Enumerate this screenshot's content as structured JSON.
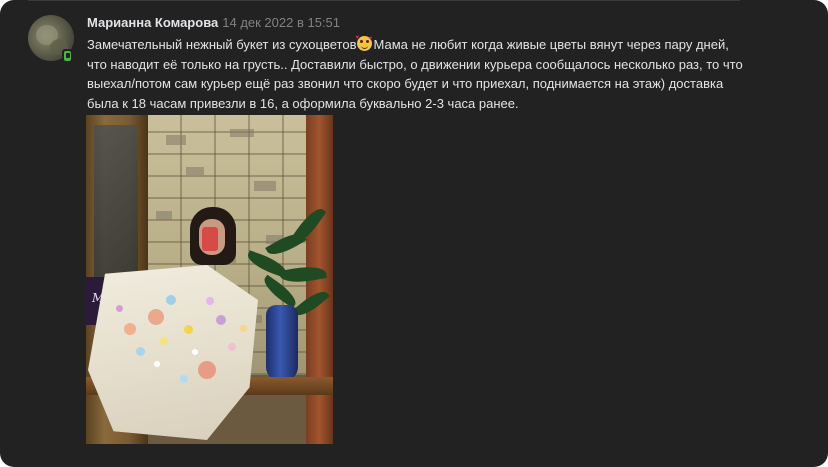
{
  "review": {
    "author": "Марианна Комарова",
    "date": "14 дек 2022 в 15:51",
    "text_before_emoji": "Замечательный нежный букет из сухоцветов",
    "emoji": "smiling-face-with-hearts",
    "text_after_emoji": "Мама не любит когда живые цветы вянут через пару дней, что наводит её только на грусть.. Доставили быстро, о движении курьера сообщалось несколько раз, то что выехал/потом сам курьер ещё раз звонил что скоро будет и что приехал, поднимается на этаж) доставка была к 18 часам привезли в 16, а оформила буквально 2-3 часа ранее.",
    "online_status": "mobile",
    "photo": {
      "card_text": "M.Dec"
    }
  },
  "colors": {
    "background": "#222222",
    "author": "#e1e3e6",
    "date": "#828282",
    "text": "#e1e3e6",
    "online": "#4bb34b"
  }
}
